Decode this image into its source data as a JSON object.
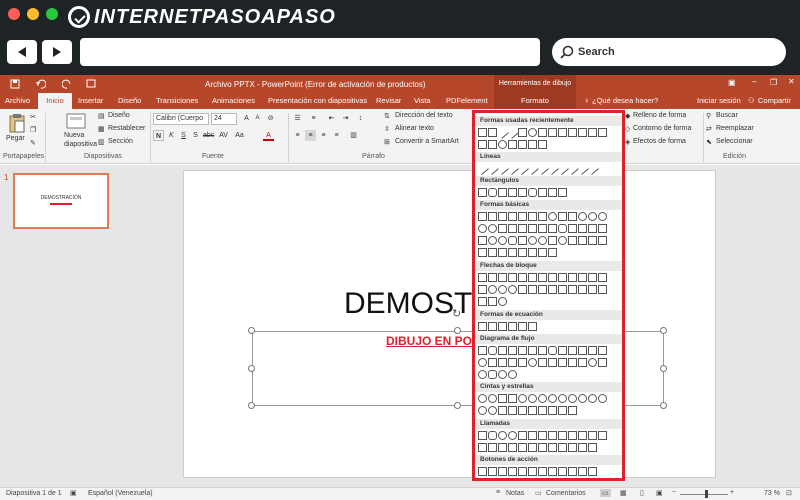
{
  "browser": {
    "logo_text": "INTERNETPASOAPASO",
    "search_label": "Search",
    "dot_colors": [
      "#ff5f56",
      "#ffbd2e",
      "#27c93f"
    ]
  },
  "ppt": {
    "window_title": "Archivo PPTX - PowerPoint (Error de activación de productos)",
    "tools_label": "Herramientas de dibujo",
    "tabs": [
      "Archivo",
      "Inicio",
      "Insertar",
      "Diseño",
      "Transiciones",
      "Animaciones",
      "Presentación con diapositivas",
      "Revisar",
      "Vista",
      "PDFelement"
    ],
    "format_tab": "Formato",
    "tell_me": "¿Qué desea hacer?",
    "signin": "Iniciar sesión",
    "share": "Compartir",
    "ribbon": {
      "paste": "Pegar",
      "new_slide": "Nueva diapositiva",
      "layout": "Diseño",
      "reset": "Restablecer",
      "section": "Sección",
      "font_name": "Calibri (Cuerpo",
      "font_size": "24",
      "text_direction": "Dirección del texto",
      "align_text": "Alinear texto",
      "smartart": "Convertir a SmartArt",
      "shape_fill": "Relleno de forma",
      "shape_outline": "Contorno de forma",
      "shape_effects": "Efectos de forma",
      "find": "Buscar",
      "replace": "Reemplazar",
      "select": "Seleccionar",
      "groups": {
        "clipboard": "Portapapeles",
        "slides": "Diapositivas",
        "font": "Fuente",
        "paragraph": "Párrafo",
        "editing": "Edición"
      }
    },
    "thumb_number": "1",
    "thumb_text": "DEMOSTRACIÓN",
    "slide_title": "DEMOSTR",
    "slide_subtitle": "DIBUJO EN POW",
    "status": {
      "slide": "Diapositiva 1 de 1",
      "language": "Español (Venezuela)",
      "notes": "Notas",
      "comments": "Comentarios",
      "zoom": "73 %"
    }
  },
  "shapes_menu": {
    "sections": [
      "Formas usadas recientemente",
      "Líneas",
      "Rectángulos",
      "Formas básicas",
      "Flechas de bloque",
      "Formas de ecuación",
      "Diagrama de flujo",
      "Cintas y estrellas",
      "Llamadas",
      "Botones de acción"
    ]
  },
  "colors": {
    "ppt_accent": "#b7472a",
    "highlight_border": "#e0202b",
    "subtitle_red": "#e0202b"
  }
}
